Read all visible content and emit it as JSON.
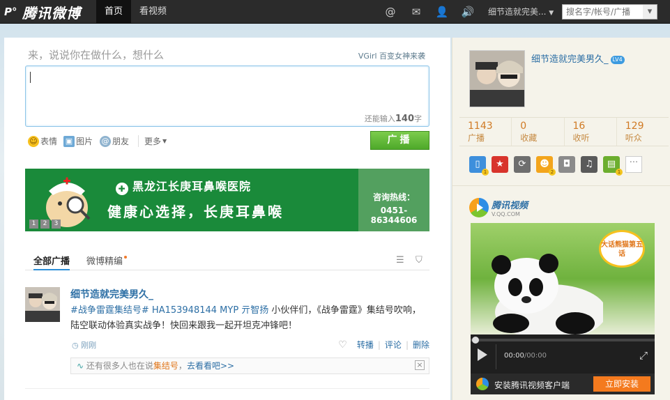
{
  "header": {
    "logo_text": "腾讯微博",
    "tabs": [
      {
        "label": "首页"
      },
      {
        "label": "看视频"
      }
    ],
    "user_menu": "细节造就完美...",
    "search_placeholder": "搜名字/帐号/广播"
  },
  "composer": {
    "hint": "来，说说你在做什么，想什么",
    "promo": "VGirl 百变女神来袭",
    "count_prefix": "还能输入",
    "count_value": "140",
    "count_suffix": "字",
    "tools": [
      {
        "label": "表情"
      },
      {
        "label": "图片"
      },
      {
        "label": "朋友"
      },
      {
        "label": "更多"
      }
    ],
    "post_label": "广播"
  },
  "banner": {
    "hospital": "黑龙江长庚耳鼻喉医院",
    "slogan": "健康心选择，长庚耳鼻喉",
    "hotline_title": "咨询热线：",
    "hotline_number": "0451-86344606",
    "pages": [
      "1",
      "2",
      "3"
    ]
  },
  "feed": {
    "tabs": [
      {
        "label": "全部广播"
      },
      {
        "label": "微博精编"
      }
    ],
    "post": {
      "author": "细节造就完美男久_",
      "tag": "#战争雷霆集结号# HA153948144 MYP 亓智扬",
      "text": " 小伙伴们，《战争雷霆》集结号吹响，陆空联动体验真实战争！快回来跟我一起开坦克冲锋吧！",
      "time": "刚刚",
      "actions": [
        "转播",
        "评论",
        "删除"
      ]
    },
    "related": {
      "prefix": "还有很多人也在说",
      "keyword": "集结号",
      "sep": "，",
      "link": "去看看吧>>"
    }
  },
  "sidebar": {
    "name": "细节造就完美男久_",
    "level": "LV4",
    "stats": [
      {
        "num": "1143",
        "label": "广播"
      },
      {
        "num": "0",
        "label": "收藏"
      },
      {
        "num": "16",
        "label": "收听"
      },
      {
        "num": "129",
        "label": "听众"
      }
    ],
    "apps_more": "···",
    "video": {
      "brand": "腾讯视频",
      "brand_sub": "V.QQ.COM",
      "bubble": "大话熊猫第五话",
      "time_current": "00:00",
      "time_total": "/00:00",
      "install_text": "安装腾讯视频客户端",
      "install_button": "立即安装"
    }
  }
}
